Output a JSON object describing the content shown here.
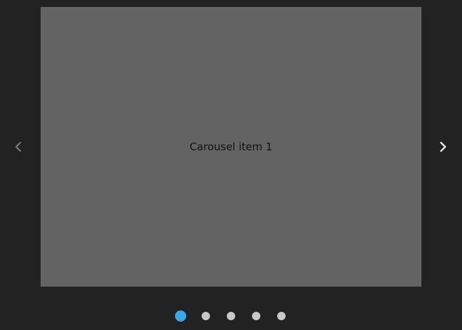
{
  "carousel": {
    "current_item_label": "Carousel item 1",
    "total_items": 5,
    "active_index": 0,
    "prev_icon": "chevron-left-icon",
    "next_icon": "chevron-right-icon"
  },
  "colors": {
    "background": "#222222",
    "slide": "#636363",
    "dot_active": "#3aa9e4",
    "dot_inactive": "#c8c8c8",
    "arrow_prev": "#7a7a7a",
    "arrow_next": "#e6e6e6"
  }
}
